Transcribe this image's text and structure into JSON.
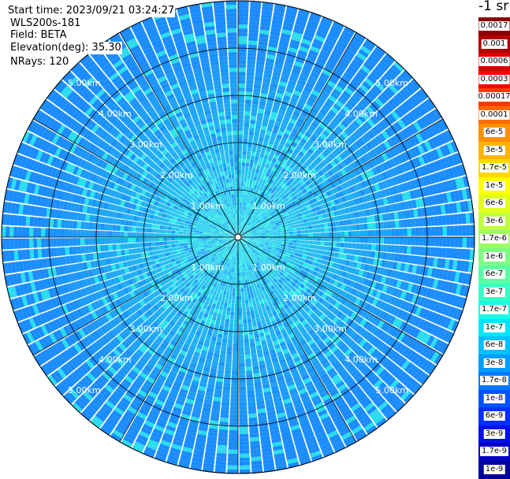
{
  "info": {
    "start_time": "Start time: 2023/09/21 03:24:27",
    "instrument": "WLS200s-181",
    "field": "Field: BETA",
    "elevation": "Elevation(deg): 35.30",
    "nrays": "NRays: 120"
  },
  "chart_data": {
    "type": "heatmap",
    "projection": "polar (PPI scan)",
    "field": "BETA",
    "elevation_deg": 35.3,
    "n_rays": 120,
    "range_rings_km": [
      1.0,
      2.0,
      3.0,
      4.0,
      5.0
    ],
    "ring_labels": [
      "1.00km",
      "2.00km",
      "3.00km",
      "4.00km",
      "5.00km"
    ],
    "colorbar": {
      "unit_title": "-1 sr",
      "labels": [
        "0.0017",
        "0.001",
        "0.0006",
        "0.0003",
        "0.00017",
        "0.0001",
        "6e-5",
        "3e-5",
        "1.7e-5",
        "1e-5",
        "6e-6",
        "3e-6",
        "1.7e-6",
        "1e-6",
        "6e-7",
        "3e-7",
        "1.7e-7",
        "1e-7",
        "6e-8",
        "3e-8",
        "1.7e-8",
        "1e-8",
        "6e-9",
        "3e-9",
        "1.7e-9",
        "1e-9"
      ],
      "colors": [
        "#8a0000",
        "#b00000",
        "#d80000",
        "#ff0000",
        "#ff3c00",
        "#ff6a00",
        "#ff9000",
        "#ffb400",
        "#ffd800",
        "#ffff00",
        "#e2ff1c",
        "#c0ff40",
        "#9cff62",
        "#7cff82",
        "#5affa4",
        "#38ffc6",
        "#14ffe6",
        "#00e4ff",
        "#00c0ff",
        "#009cff",
        "#0078ff",
        "#0054ff",
        "#0030ff",
        "#0010ea",
        "#0000c4",
        "#00009a"
      ]
    },
    "dominant_value_range": [
      "1e-8",
      "1.7e-7"
    ],
    "colors": {
      "far_field": "#1a8cff",
      "mid_field": "#20b8f2",
      "near_field": "#2ef0e8",
      "grid": "#000000",
      "gaps": "#ffffff"
    }
  }
}
